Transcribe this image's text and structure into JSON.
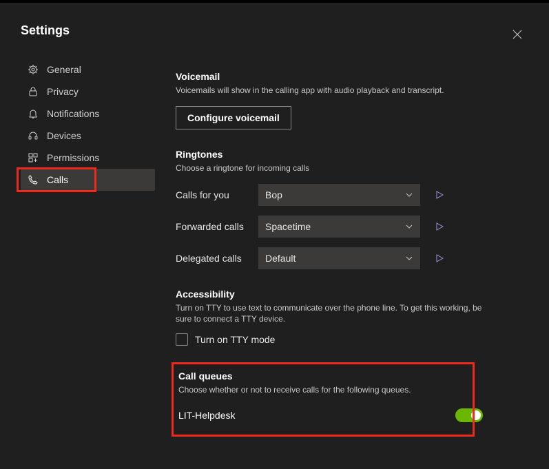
{
  "title": "Settings",
  "sidebar": {
    "items": [
      {
        "icon": "gear",
        "label": "General"
      },
      {
        "icon": "lock",
        "label": "Privacy"
      },
      {
        "icon": "bell",
        "label": "Notifications"
      },
      {
        "icon": "headset",
        "label": "Devices"
      },
      {
        "icon": "apps",
        "label": "Permissions"
      },
      {
        "icon": "phone",
        "label": "Calls"
      }
    ],
    "selected_index": 5
  },
  "voicemail": {
    "heading": "Voicemail",
    "desc": "Voicemails will show in the calling app with audio playback and transcript.",
    "button": "Configure voicemail"
  },
  "ringtones": {
    "heading": "Ringtones",
    "desc": "Choose a ringtone for incoming calls",
    "rows": [
      {
        "label": "Calls for you",
        "value": "Bop"
      },
      {
        "label": "Forwarded calls",
        "value": "Spacetime"
      },
      {
        "label": "Delegated calls",
        "value": "Default"
      }
    ]
  },
  "accessibility": {
    "heading": "Accessibility",
    "desc": "Turn on TTY to use text to communicate over the phone line. To get this working, be sure to connect a TTY device.",
    "checkbox_label": "Turn on TTY mode",
    "checked": false
  },
  "call_queues": {
    "heading": "Call queues",
    "desc": "Choose whether or not to receive calls for the following queues.",
    "queues": [
      {
        "name": "LIT-Helpdesk",
        "enabled": true
      }
    ]
  }
}
